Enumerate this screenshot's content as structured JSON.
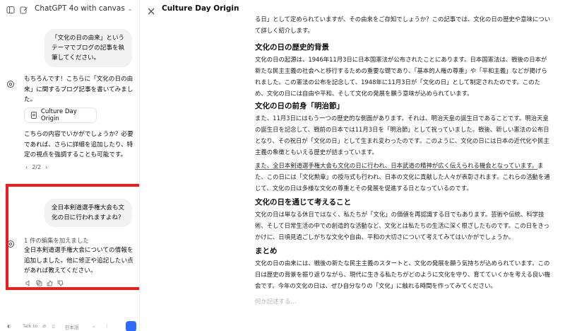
{
  "app": {
    "title": "ChatGPT 4o with canvas"
  },
  "chat": {
    "user1": "「文化の日の由来」というテーマでブログの記事を執筆してください。",
    "assistant1": "もちろんです！こちらに「文化の日の由来」に関するブログ記事を書いてみました。",
    "doc_chip": "Culture Day Origin",
    "assistant1_followup": "こちらの内容でいかがでしょうか？必要であれば、さらに詳細を追加したり、特定の視点を強調することも可能です。",
    "pager": "2/2",
    "user2": "全日本剣道選手権大会も文化の日に行われますよね？",
    "edit_note": "1 件の編集を加えました",
    "assistant2": "全日本剣道選手権大会についての情報を追加しました。他に修正や追記したい点があれば教えてください。",
    "composer": {
      "talk_to": "Talk to",
      "language": "日本語"
    }
  },
  "canvas": {
    "title": "Culture Day Origin",
    "intro": "る日」として定められていますが、その由来をご存知でしょうか？この記事では、文化の日の歴史や意味について詳しく紹介します。",
    "h1": "文化の日の歴史的背景",
    "p1": "文化の日の起源は、1946年11月3日に日本国憲法が公布されたことにあります。日本国憲法は、戦後の日本が新たな民主主義の社会へと移行するための重要な礎であり、「基本的人権の尊重」や「平和主義」などが掲げられました。この憲法の公布を記念して、1948年に11月3日が「文化の日」として制定されたのです。このため、文化の日には自由や平和、そして文化の発展を願う意味が込められています。",
    "h2": "文化の日の前身「明治節」",
    "p2": "また、11月3日にはもう一つの歴史的な側面があります。それは、明治天皇の誕生日であることです。明治天皇の誕生日を記念して、戦前の日本では11月3日を「明治節」として祝っていました。戦後、新しい憲法の公布日となり、その祝日が「文化の日」として生まれ変わったのです。このように、文化の日には日本の近代化や民主主義の象徴ともいえる歴史が詰まっています。",
    "p3_underlined": "また、全日本剣道選手権大会も文化の日に行われ、日本武道の精神が広く伝えられる機会となっています。",
    "p3_rest": "また、この日には「文化勲章」の授与式も行われ、日本の文化に貢献した人々が表彰されます。これらの活動を通じて、文化の日は多様な文化の尊重とその発展を促進する日となっているのです。",
    "h4": "文化の日を通じて考えること",
    "p4": "文化の日は単なる休日ではなく、私たちが「文化」の価値を再認識する日でもあります。芸術や伝統、科学技術、そして日常生活の中での創造的な活動など、文化とは私たちの生活に深く根ざしたものです。この日をきっかけに、日頃見過ごしがちな文化や自由、平和の大切さについて考えてみてはいかがでしょうか。",
    "h5": "まとめ",
    "p5": "文化の日の由来には、戦後の新たな民主主義のスタートと、文化の発展を願う気持ちが込められています。この日は歴史の背景を振り返りながら、現代に生きる私たちがどのように文化を守り、育てていくかを考える良い機会です。今年の文化の日は、ぜひ自分なりの「文化」に触れる時間を作ってみてください。",
    "placeholder": "何か記述する..."
  },
  "colors": {
    "highlight_box": "#ee1c1c",
    "underline": "#e0322c",
    "mic_button": "#2d6bff"
  }
}
